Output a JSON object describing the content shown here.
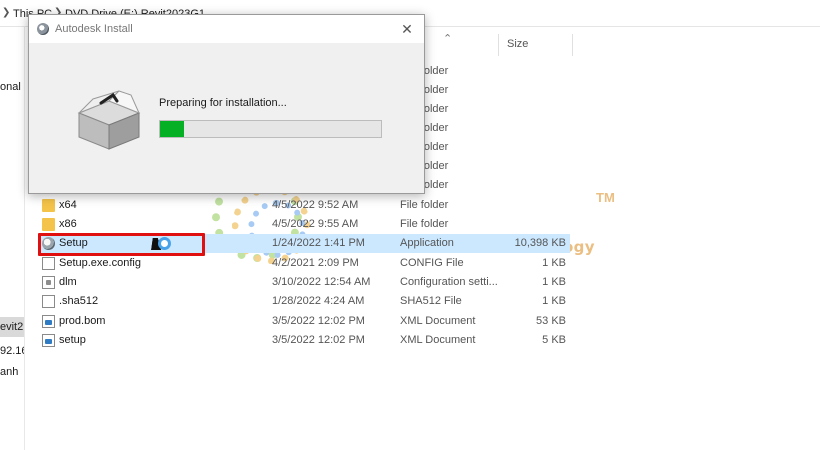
{
  "window": {
    "breadcrumbs": [
      "This PC",
      "DVD Drive (E:) Revit2023G1"
    ]
  },
  "navpane": {
    "items": [
      {
        "label": "onal"
      },
      {
        "label": "evit2"
      },
      {
        "label": "92.16"
      },
      {
        "label": "anh"
      }
    ]
  },
  "columns": {
    "size": "Size"
  },
  "files": [
    {
      "name": "",
      "date": "",
      "type": "File folder",
      "size": "",
      "icon": "folder-icon"
    },
    {
      "name": "",
      "date": "",
      "type": "File folder",
      "size": "",
      "icon": "folder-icon"
    },
    {
      "name": "",
      "date": "",
      "type": "File folder",
      "size": "",
      "icon": "folder-icon"
    },
    {
      "name": "",
      "date": "",
      "type": "File folder",
      "size": "",
      "icon": "folder-icon"
    },
    {
      "name": "",
      "date": "",
      "type": "File folder",
      "size": "",
      "icon": "folder-icon"
    },
    {
      "name": "",
      "date": "",
      "type": "File folder",
      "size": "",
      "icon": "folder-icon"
    },
    {
      "name": "",
      "date": "",
      "type": "File folder",
      "size": "",
      "icon": "folder-icon"
    },
    {
      "name": "x64",
      "date": "4/5/2022 9:52 AM",
      "type": "File folder",
      "size": "",
      "icon": "folder-icon"
    },
    {
      "name": "x86",
      "date": "4/5/2022 9:55 AM",
      "type": "File folder",
      "size": "",
      "icon": "folder-icon"
    },
    {
      "name": "Setup",
      "date": "1/24/2022 1:41 PM",
      "type": "Application",
      "size": "10,398 KB",
      "icon": "setup-icon",
      "selected": true
    },
    {
      "name": "Setup.exe.config",
      "date": "4/2/2021 2:09 PM",
      "type": "CONFIG File",
      "size": "1 KB",
      "icon": "file-icon"
    },
    {
      "name": "dlm",
      "date": "3/10/2022 12:54 AM",
      "type": "Configuration setti...",
      "size": "1 KB",
      "icon": "dlm-icon"
    },
    {
      "name": ".sha512",
      "date": "1/28/2022 4:24 AM",
      "type": "SHA512 File",
      "size": "1 KB",
      "icon": "file-icon"
    },
    {
      "name": "prod.bom",
      "date": "3/5/2022 12:02 PM",
      "type": "XML Document",
      "size": "53 KB",
      "icon": "xml-icon"
    },
    {
      "name": "setup",
      "date": "3/5/2022 12:02 PM",
      "type": "XML Document",
      "size": "5 KB",
      "icon": "xml-icon"
    }
  ],
  "dialog": {
    "title": "Autodesk Install",
    "status": "Preparing for installation...",
    "progress": 0.11,
    "progress_color": "#06b025"
  },
  "watermark": {
    "text": "information technology",
    "tm": "TM"
  },
  "colors": {
    "selection": "#cce8ff",
    "highlight_border": "#e01010"
  }
}
